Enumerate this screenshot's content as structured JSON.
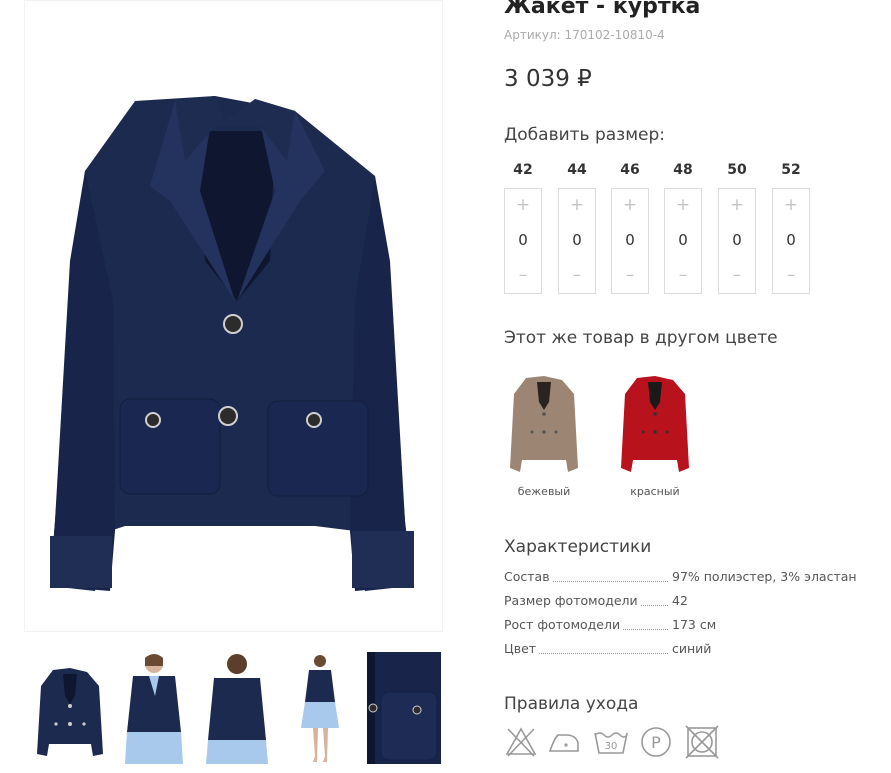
{
  "product": {
    "title": "Жакет - куртка",
    "sku": "Артикул: 170102-10810-4",
    "price": "3 039 ₽"
  },
  "sizes": {
    "title": "Добавить размер:",
    "items": [
      {
        "size": "42",
        "plus": "+",
        "qty": "0",
        "minus": "–"
      },
      {
        "size": "44",
        "plus": "+",
        "qty": "0",
        "minus": "–"
      },
      {
        "size": "46",
        "plus": "+",
        "qty": "0",
        "minus": "–"
      },
      {
        "size": "48",
        "plus": "+",
        "qty": "0",
        "minus": "–"
      },
      {
        "size": "50",
        "plus": "+",
        "qty": "0",
        "minus": "–"
      },
      {
        "size": "52",
        "plus": "+",
        "qty": "0",
        "minus": "–"
      }
    ]
  },
  "colors": {
    "title": "Этот же товар в другом цвете",
    "items": [
      {
        "name": "бежевый",
        "swatch": "#9c8573"
      },
      {
        "name": "красный",
        "swatch": "#b8121c"
      }
    ]
  },
  "specs": {
    "title": "Характеристики",
    "rows": [
      {
        "label": "Состав",
        "value": "97% полиэстер, 3% эластан"
      },
      {
        "label": "Размер фотомодели",
        "value": "42"
      },
      {
        "label": "Рост фотомодели",
        "value": "173 см"
      },
      {
        "label": "Цвет",
        "value": "синий"
      }
    ]
  },
  "care": {
    "title": "Правила ухода",
    "icons": [
      "no-bleach-icon",
      "low-iron-icon",
      "wash-30-icon",
      "dry-clean-p-icon",
      "no-tumble-dry-icon"
    ],
    "wash_temp": "30",
    "dry_clean_letter": "P"
  },
  "gallery": {
    "main_color": "#1c2a4f",
    "thumbs": [
      "jacket-front",
      "model-front",
      "model-back",
      "model-full",
      "pocket-detail"
    ],
    "active_thumb": 0,
    "accent": "#3fd2b4"
  }
}
